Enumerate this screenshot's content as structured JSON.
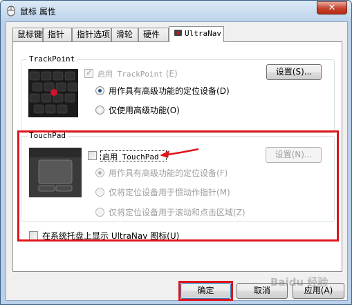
{
  "window": {
    "title": "鼠标 属性",
    "close": "✕"
  },
  "tabs": [
    {
      "label": "鼠标键"
    },
    {
      "label": "指针"
    },
    {
      "label": "指针选项"
    },
    {
      "label": "滑轮"
    },
    {
      "label": "硬件"
    },
    {
      "label": "UltraNav",
      "active": true
    }
  ],
  "trackpoint": {
    "group_label": "TrackPoint",
    "enable_label": "启用 TrackPoint",
    "enable_key": "(E)",
    "settings_button": "设置(S)...",
    "option_advanced": "用作具有高级功能的定位设备",
    "option_advanced_key": "(D)",
    "option_only": "仅使用高级功能",
    "option_only_key": "(O)"
  },
  "touchpad": {
    "group_label": "TouchPad",
    "enable_label": "启用 TouchPad",
    "settings_button": "设置(N)...",
    "option_advanced": "用作具有高级功能的定位设备",
    "option_advanced_key": "(F)",
    "option_inertial": "仅将定位设备用于惯动作指针",
    "option_inertial_key": "(M)",
    "option_scroll": "仅将定位设备用于滚动和点击区域",
    "option_scroll_key": "(Z)"
  },
  "tray": {
    "label": "在系统托盘上显示 UltraNav 图标",
    "key": "(U)"
  },
  "buttons": {
    "ok": "确定",
    "cancel": "取消",
    "apply": "应用(A)"
  },
  "watermark": "Baidu 经验",
  "colors": {
    "highlight": "#e0141b",
    "accent": "#1f4e8c"
  }
}
